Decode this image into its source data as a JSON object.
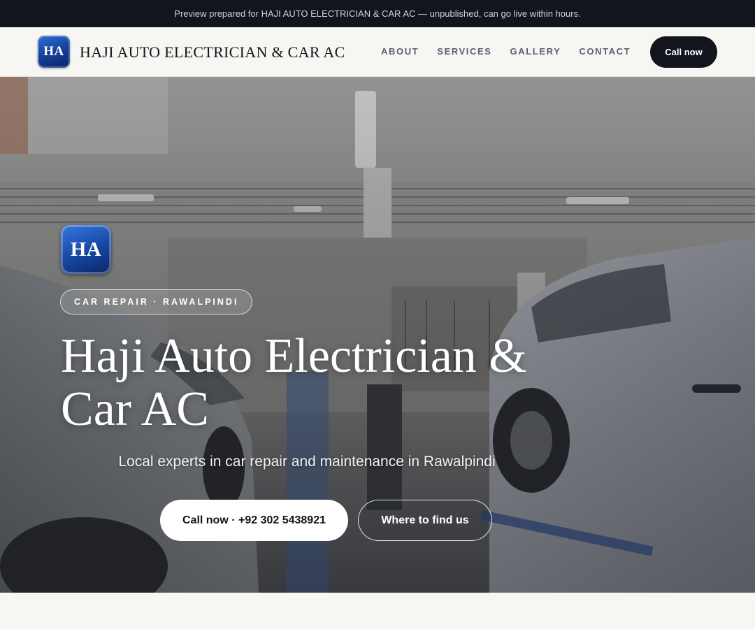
{
  "preview_bar": {
    "text": "Preview prepared for HAJI AUTO ELECTRICIAN & CAR AC — unpublished, can go live within hours."
  },
  "header": {
    "logo_initials": "HA",
    "brand_name": "HAJI AUTO ELECTRICIAN & CAR AC",
    "nav_items": [
      {
        "label": "ABOUT"
      },
      {
        "label": "SERVICES"
      },
      {
        "label": "GALLERY"
      },
      {
        "label": "CONTACT"
      }
    ],
    "call_button": "Call now"
  },
  "hero": {
    "logo_initials": "HA",
    "badge": "CAR REPAIR · RAWALPINDI",
    "title": "Haji Auto Electrician & Car AC",
    "subtitle": "Local experts in car repair and maintenance in Rawalpindi",
    "primary_cta": "Call now · +92 302 5438921",
    "secondary_cta": "Where to find us",
    "background_image": "garage-workshop-photo"
  },
  "colors": {
    "topbar_bg": "#12151c",
    "page_bg": "#f7f6f3",
    "logo_blue": "#184aa8",
    "text_dark": "#14161c",
    "nav_text": "#5b6270"
  }
}
